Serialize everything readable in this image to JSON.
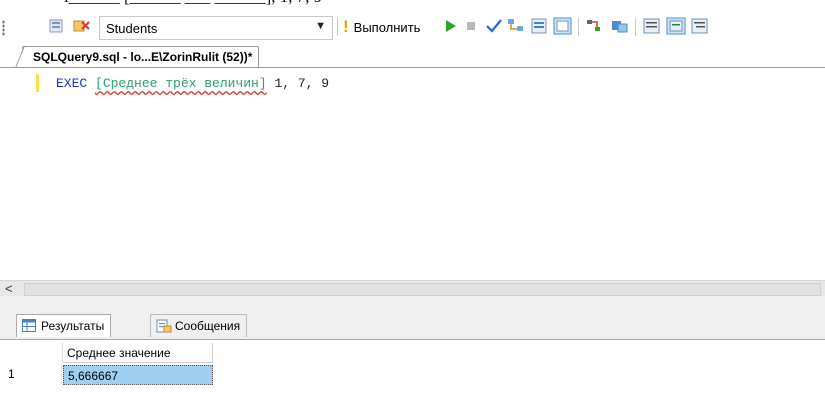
{
  "toolbar": {
    "database": "Students",
    "execute_label": "Выполнить"
  },
  "tab": {
    "title": "SQLQuery9.sql - lo...E\\ZorinRulit (52))*"
  },
  "editor": {
    "keyword": "EXEC",
    "object": "[Среднее трёх величин]",
    "args": " 1, 7, 9"
  },
  "results": {
    "tabs": [
      "Результаты",
      "Сообщения"
    ],
    "column_header": "Среднее значение",
    "row_number": "1",
    "value": "5,666667"
  },
  "colors": {
    "keyword": "#1f35c9",
    "object": "#2aa26a",
    "selection": "#9fd0f2"
  }
}
